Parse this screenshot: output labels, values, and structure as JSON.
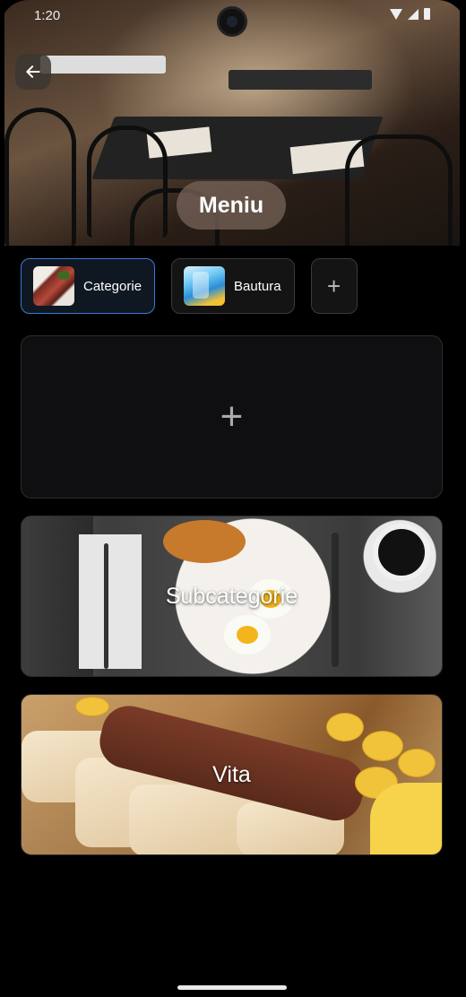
{
  "status_bar": {
    "time": "1:20"
  },
  "header": {
    "title": "Meniu"
  },
  "category_tabs": [
    {
      "label": "Categorie",
      "thumbnail": "roast-meat-image",
      "selected": true
    },
    {
      "label": "Bautura",
      "thumbnail": "drink-image",
      "selected": false
    }
  ],
  "add_category_symbol": "+",
  "add_card_symbol": "+",
  "subcategories": [
    {
      "label": "Subcategorie",
      "image": "breakfast-plate-image"
    },
    {
      "label": "Vita",
      "image": "kebab-with-potatoes-image"
    }
  ],
  "colors": {
    "accent": "#3b7bd6",
    "background": "#000000",
    "card_background": "#0f0f12"
  },
  "icons": {
    "back": "arrow-left-icon",
    "add": "plus-icon"
  }
}
